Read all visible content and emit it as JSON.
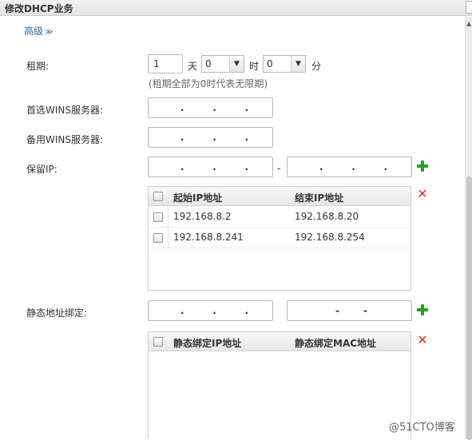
{
  "dialog": {
    "title": "修改DHCP业务"
  },
  "advanced": {
    "label": "高级",
    "chevron": "≫"
  },
  "lease": {
    "label": "租期:",
    "days_value": "1",
    "days_unit": "天",
    "hours_value": "0",
    "hours_unit": "时",
    "minutes_value": "0",
    "minutes_unit": "分",
    "hint": "(租期全部为0时代表无限期)"
  },
  "primary_wins": {
    "label": "首选WINS服务器:"
  },
  "secondary_wins": {
    "label": "备用WINS服务器:"
  },
  "reserved_ip": {
    "label": "保留IP:",
    "separator": "-",
    "table": {
      "headers": [
        "起始IP地址",
        "结束IP地址"
      ],
      "rows": [
        [
          "192.168.8.2",
          "192.168.8.20"
        ],
        [
          "192.168.8.241",
          "192.168.8.254"
        ]
      ]
    }
  },
  "static_binding": {
    "label": "静态地址绑定:",
    "mac_placeholder": "-  -",
    "table": {
      "headers": [
        "静态绑定IP地址",
        "静态绑定MAC地址"
      ]
    }
  },
  "ip_placeholder": ".  .  .",
  "watermark": "@51CTO博客",
  "colors": {
    "accent": "#2a6aa6",
    "add": "#2f9a27",
    "delete": "#d63226"
  }
}
